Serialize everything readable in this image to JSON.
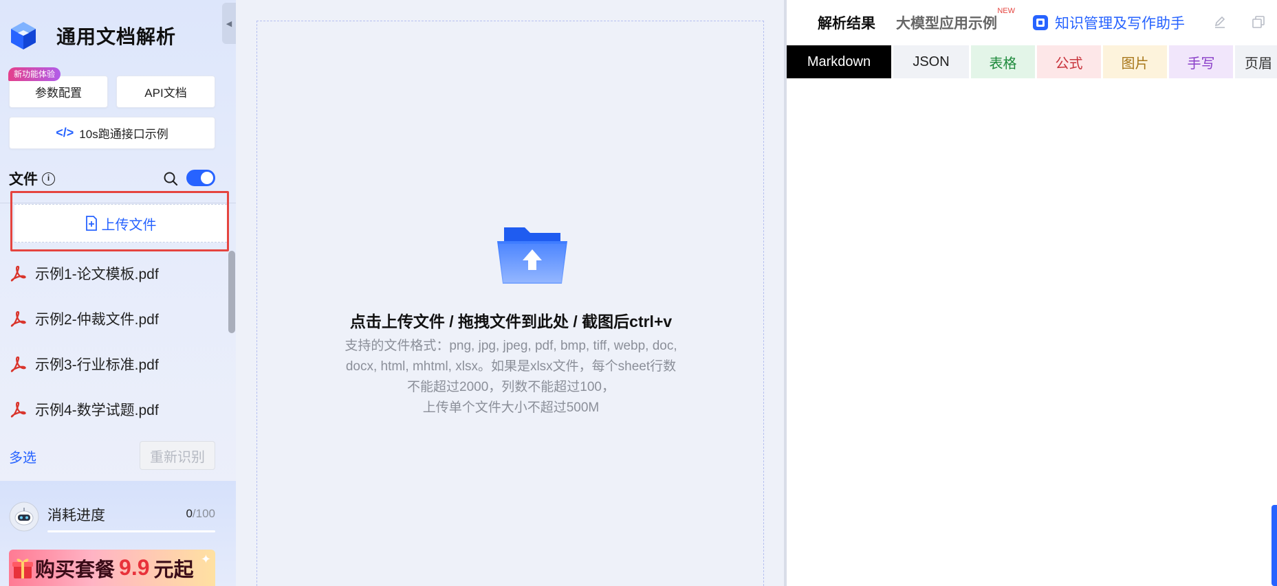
{
  "app": {
    "title": "通用文档解析"
  },
  "sidebar": {
    "new_badge": "新功能体验",
    "param_button": "参数配置",
    "api_button": "API文档",
    "demo_button": "10s跑通接口示例",
    "files_title": "文件",
    "upload_label": "上传文件",
    "files": [
      {
        "name": "示例1-论文模板.pdf"
      },
      {
        "name": "示例2-仲裁文件.pdf"
      },
      {
        "name": "示例3-行业标准.pdf"
      },
      {
        "name": "示例4-数学试题.pdf"
      }
    ],
    "multi_select": "多选",
    "reidentify": "重新识别",
    "usage": {
      "label": "消耗进度",
      "used": "0",
      "total": "/100",
      "fraction": 0.0
    },
    "promo": {
      "prefix": "购买套餐",
      "price": "9.9",
      "suffix": "元起"
    }
  },
  "dropzone": {
    "title": "点击上传文件 / 拖拽文件到此处 / 截图后ctrl+v",
    "desc_line1": "支持的文件格式：png, jpg, jpeg, pdf, bmp, tiff, webp, doc, docx, html, mhtml, xlsx。如果是xlsx文件，每个sheet行数不能超过2000，列数不能超过100，",
    "desc_line2": "上传单个文件大小不超过500M"
  },
  "result": {
    "tabs": [
      {
        "label": "解析结果",
        "active": true
      },
      {
        "label": "大模型应用示例",
        "active": false,
        "tag": "NEW"
      }
    ],
    "kb_link": "知识管理及写作助手",
    "format_tabs": [
      {
        "label": "Markdown",
        "bg": "#000000",
        "fg": "#ffffff"
      },
      {
        "label": "JSON",
        "bg": "#f0f2f6",
        "fg": "#222222"
      },
      {
        "label": "表格",
        "bg": "#e3f5e8",
        "fg": "#1e8a3c"
      },
      {
        "label": "公式",
        "bg": "#fde7e8",
        "fg": "#c8333b"
      },
      {
        "label": "图片",
        "bg": "#fdf3dc",
        "fg": "#a8771a"
      },
      {
        "label": "手写",
        "bg": "#f1e6fb",
        "fg": "#8a3fc8"
      },
      {
        "label": "页眉",
        "bg": "#f0f2f6",
        "fg": "#333333"
      }
    ]
  },
  "colors": {
    "accent": "#2763ff",
    "highlight": "#e5443f"
  }
}
